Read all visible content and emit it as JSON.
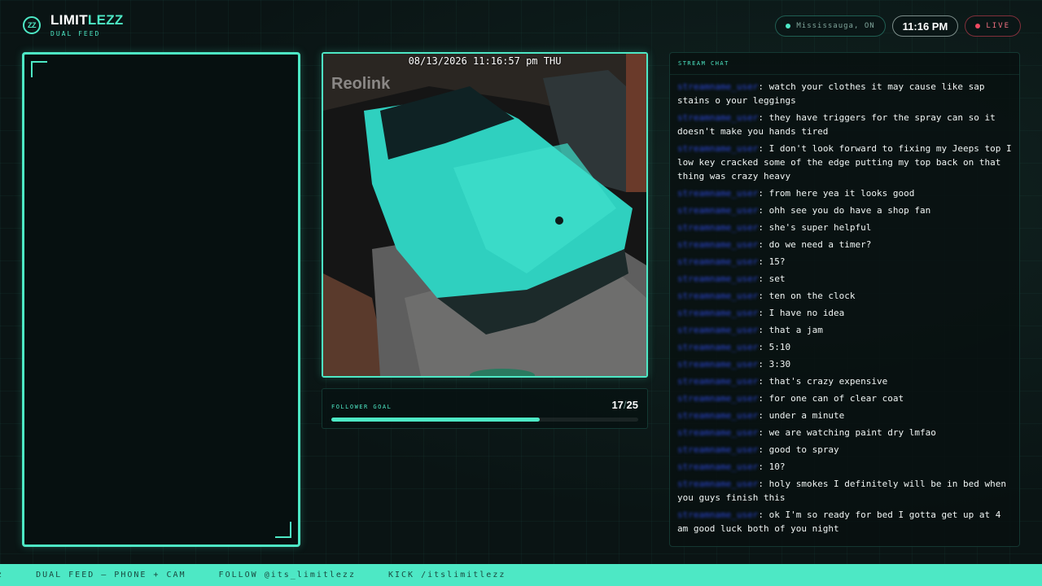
{
  "brand": {
    "logo_text": "ZZ",
    "title_prefix": "LIMIT",
    "title_accent": "LEZZ",
    "subtitle": "DUAL FEED"
  },
  "status": {
    "location": "Mississauga, ON",
    "time": "11:16 PM",
    "live": "LIVE"
  },
  "camera": {
    "timestamp": "08/13/2026 11:16:57 pm THU",
    "watermark": "Reolink"
  },
  "goal": {
    "label": "FOLLOWER GOAL",
    "current": "17",
    "separator": "/",
    "target": "25",
    "progress": 0.68
  },
  "chat": {
    "title": "STREAM CHAT",
    "messages": [
      {
        "user": "streamname_user",
        "text": ": watch your clothes it may cause like sap stains o your leggings"
      },
      {
        "user": "streamname_user",
        "text": ": they have triggers for the spray can so it doesn't make you hands tired"
      },
      {
        "user": "streamname_user",
        "text": ": I don't look forward to fixing my Jeeps top I low key cracked some of the edge putting my top back on that thing was crazy heavy"
      },
      {
        "user": "streamname_user",
        "text": ": from here yea it looks good"
      },
      {
        "user": "streamname_user",
        "text": ": ohh see you do have a shop fan"
      },
      {
        "user": "streamname_user",
        "text": ": she's super helpful"
      },
      {
        "user": "streamname_user",
        "text": ": do we need a timer?"
      },
      {
        "user": "streamname_user",
        "text": ": 15?"
      },
      {
        "user": "streamname_user",
        "text": ": set"
      },
      {
        "user": "streamname_user",
        "text": ": ten on the clock"
      },
      {
        "user": "streamname_user",
        "text": ": I have no idea"
      },
      {
        "user": "streamname_user",
        "text": ": that a jam"
      },
      {
        "user": "streamname_user",
        "text": ": 5:10"
      },
      {
        "user": "streamname_user",
        "text": ": 3:30"
      },
      {
        "user": "streamname_user",
        "text": ": that's crazy expensive"
      },
      {
        "user": "streamname_user",
        "text": ": for one can of clear coat"
      },
      {
        "user": "streamname_user",
        "text": ": under a minute"
      },
      {
        "user": "streamname_user",
        "text": ": we are watching paint dry lmfao"
      },
      {
        "user": "streamname_user",
        "text": ": good to spray"
      },
      {
        "user": "streamname_user",
        "text": ": 10?"
      },
      {
        "user": "streamname_user",
        "text": ": holy smokes I definitely will be in bed when you guys finish this"
      },
      {
        "user": "streamname_user",
        "text": ": ok I'm so ready for bed I gotta get up at 4 am good luck both of you night"
      }
    ]
  },
  "ticker": {
    "items": [
      "ezz",
      "DUAL FEED — PHONE + CAM",
      "FOLLOW @its_limitlezz",
      "KICK /itslimitlezz"
    ]
  },
  "colors": {
    "accent": "#4de8c5",
    "background": "#0a1414",
    "live": "#ef4a62",
    "chat_user": "#2c47d6"
  }
}
